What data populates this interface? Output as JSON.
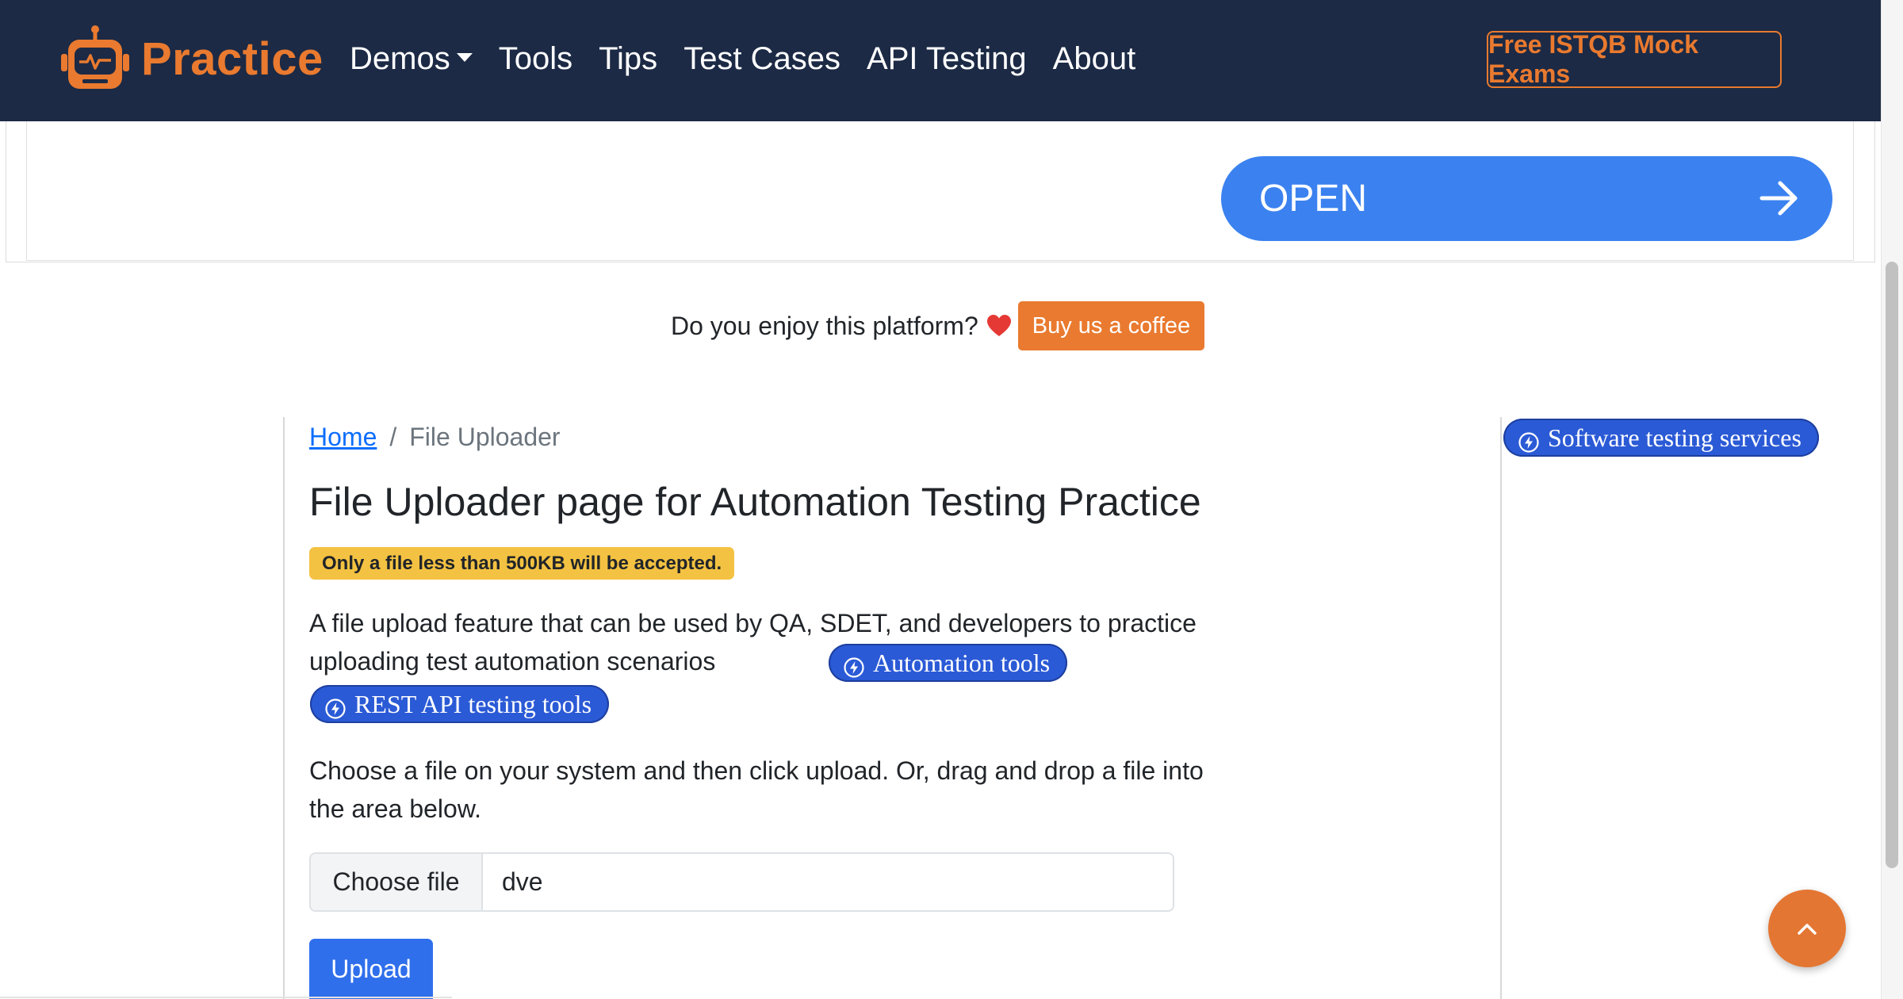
{
  "navbar": {
    "brand": "Practice",
    "links": [
      {
        "label": "Demos",
        "dropdown": true
      },
      {
        "label": "Tools"
      },
      {
        "label": "Tips"
      },
      {
        "label": "Test Cases"
      },
      {
        "label": "API Testing"
      },
      {
        "label": "About"
      }
    ],
    "cta": "Free ISTQB Mock Exams"
  },
  "ad": {
    "open_label": "OPEN"
  },
  "support": {
    "text": "Do you enjoy this platform?",
    "button": "Buy us a coffee"
  },
  "breadcrumb": {
    "home": "Home",
    "separator": "/",
    "current": "File Uploader"
  },
  "main": {
    "title": "File Uploader page for Automation Testing Practice",
    "badge": "Only a file less than 500KB will be accepted.",
    "description": "A file upload feature that can be used by QA, SDET, and developers to practice uploading test automation scenarios",
    "pills": {
      "automation": "Automation tools",
      "rest": "REST API testing tools"
    },
    "instructions": "Choose a file on your system and then click upload. Or, drag and drop a file into the area below.",
    "file_input": {
      "button": "Choose file",
      "value": "dve"
    },
    "upload": "Upload"
  },
  "sidebar": {
    "services_pill": "Software testing services"
  },
  "colors": {
    "navbar": "#1c2a45",
    "accent": "#e97a2f",
    "primary": "#2f6fec",
    "pill": "#2b5ad6",
    "warning": "#f4c242"
  },
  "icons": [
    "robot-logo-icon",
    "caret-down-icon",
    "arrow-right-icon",
    "heart-icon",
    "bolt-icon",
    "chevron-up-icon"
  ]
}
